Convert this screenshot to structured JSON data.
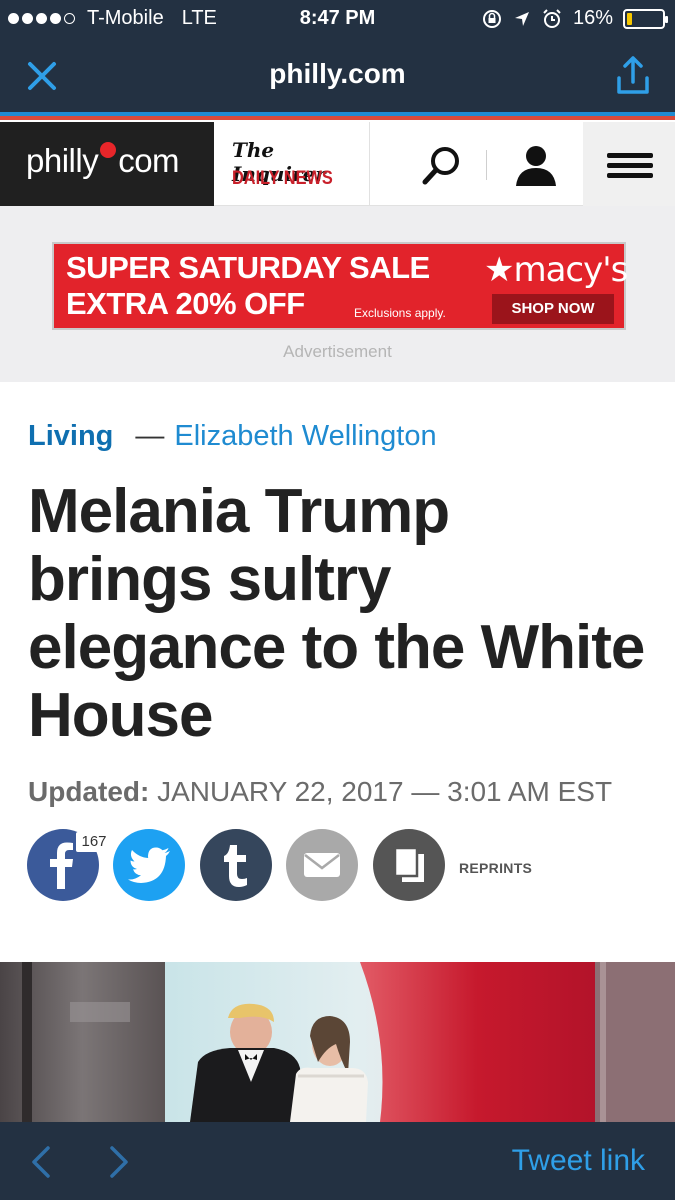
{
  "status_bar": {
    "carrier": "T-Mobile",
    "network": "LTE",
    "time": "8:47 PM",
    "battery": "16%",
    "battery_level": 0.16,
    "signal_bars": 4
  },
  "browser": {
    "url": "philly.com",
    "close_icon": "close-icon",
    "share_icon": "share-icon"
  },
  "site_header": {
    "logo_left": "philly",
    "logo_right": "com",
    "partner_title": "The Inquirer",
    "partner_subtitle": "DAILY NEWS"
  },
  "ad": {
    "line1": "SUPER SATURDAY SALE",
    "line2": "EXTRA 20% OFF",
    "fine_print": "Exclusions apply.",
    "brand": "★macy's",
    "cta": "SHOP NOW",
    "label": "Advertisement"
  },
  "article": {
    "section": "Living",
    "dash": "—",
    "author": "Elizabeth Wellington",
    "headline": "Melania Trump brings sultry elegance to the White House",
    "updated_label": "Updated:",
    "updated_value": "JANUARY 22, 2017 — 3:01 AM EST"
  },
  "share_bar": {
    "facebook_count": "167",
    "reprints_label": "REPRINTS"
  },
  "bottom_bar": {
    "tweet_link": "Tweet link"
  },
  "colors": {
    "chrome": "#233142",
    "section_blue": "#0f6fb0",
    "author_blue": "#1f8bd1",
    "ad_red": "#e2232b"
  }
}
